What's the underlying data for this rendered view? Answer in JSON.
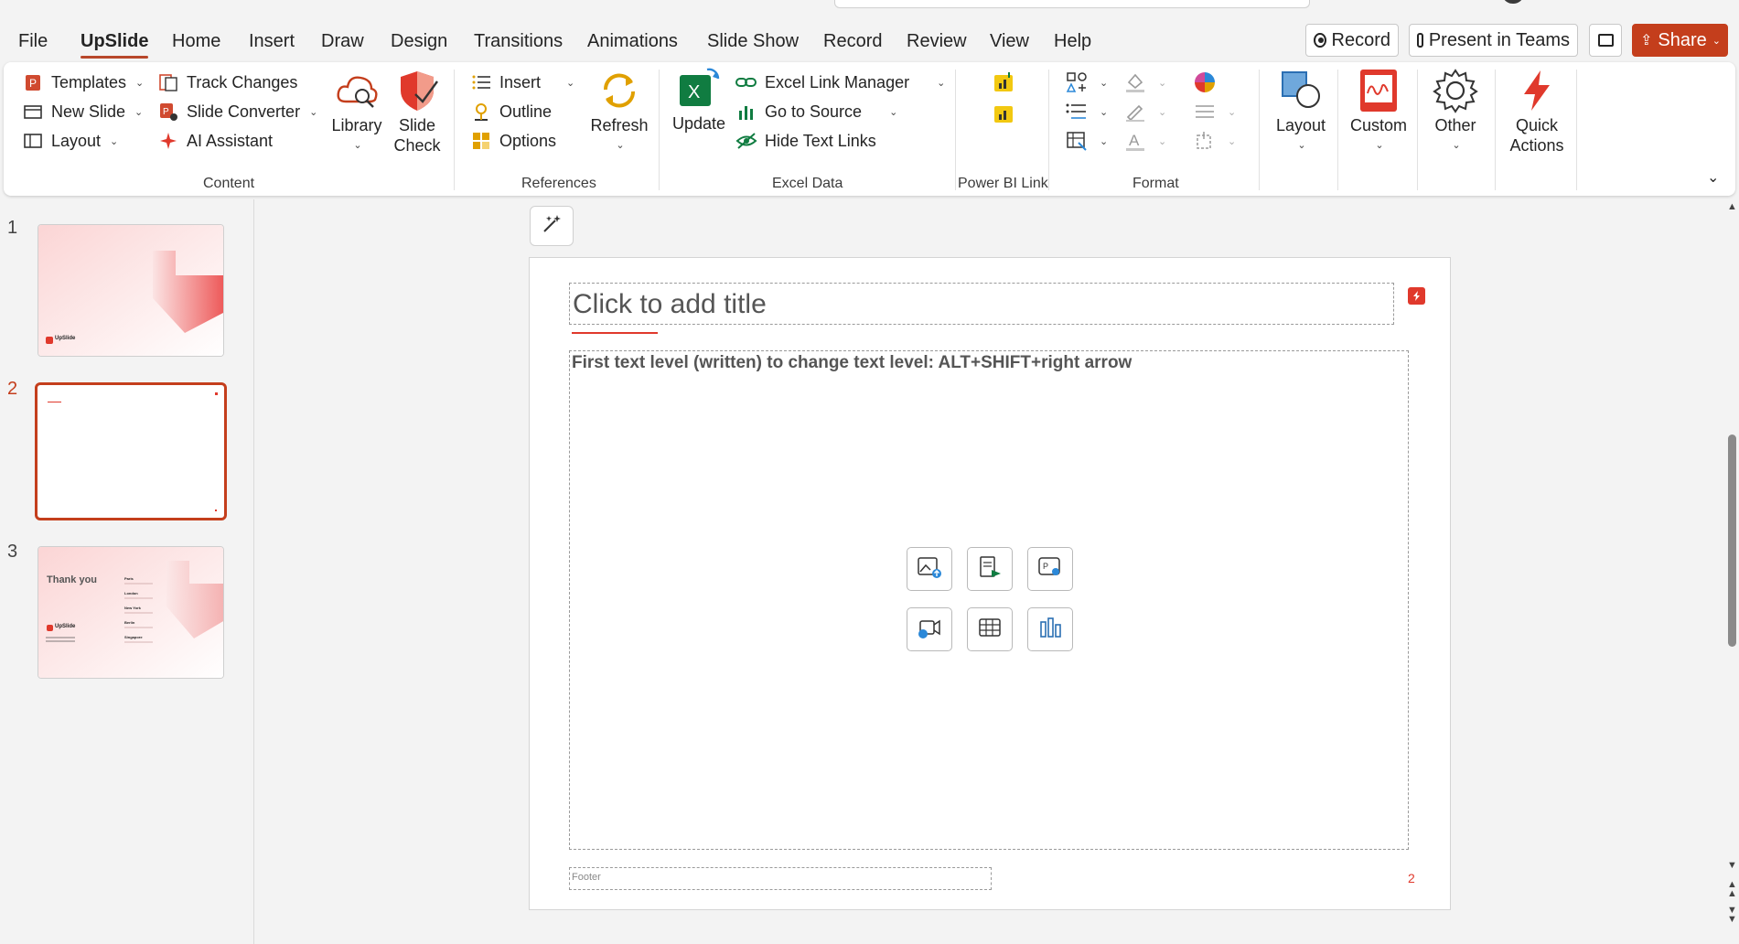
{
  "menu": {
    "tabs": [
      "File",
      "UpSlide",
      "Home",
      "Insert",
      "Draw",
      "Design",
      "Transitions",
      "Animations",
      "Slide Show",
      "Record",
      "Review",
      "View",
      "Help"
    ],
    "active_tab": "UpSlide",
    "record_label": "Record",
    "present_label": "Present in Teams",
    "share_label": "Share"
  },
  "ribbon": {
    "content": {
      "templates": "Templates",
      "new_slide": "New Slide",
      "layout": "Layout",
      "track_changes": "Track Changes",
      "slide_converter": "Slide Converter",
      "ai_assistant": "AI Assistant",
      "library": "Library",
      "slide_check_line1": "Slide",
      "slide_check_line2": "Check",
      "group_label": "Content"
    },
    "references": {
      "insert": "Insert",
      "outline": "Outline",
      "options": "Options",
      "refresh": "Refresh",
      "group_label": "References"
    },
    "excel": {
      "update": "Update",
      "link_manager": "Excel Link Manager",
      "go_to_source": "Go to Source",
      "hide_text_links": "Hide Text Links",
      "group_label": "Excel Data"
    },
    "powerbi": {
      "group_label": "Power BI Link"
    },
    "format": {
      "group_label": "Format"
    },
    "layout_btn": "Layout",
    "custom_btn": "Custom",
    "other_btn": "Other",
    "quick_actions_line1": "Quick",
    "quick_actions_line2": "Actions"
  },
  "thumbnails": [
    {
      "number": "1",
      "logo": "UpSlide"
    },
    {
      "number": "2"
    },
    {
      "number": "3",
      "heading": "Thank you",
      "cities": [
        "Paris",
        "London",
        "New York",
        "Berlin",
        "Singapore"
      ],
      "logo": "UpSlide"
    }
  ],
  "slide": {
    "title_placeholder": "Click to add title",
    "body_text": "First text level (written) to change text level: ALT+SHIFT+right arrow",
    "footer": "Footer",
    "number": "2"
  },
  "colors": {
    "accent": "#c43e1c",
    "brand_red": "#e0392c",
    "excel_green": "#107c41",
    "powerbi_yellow": "#f2c811"
  }
}
